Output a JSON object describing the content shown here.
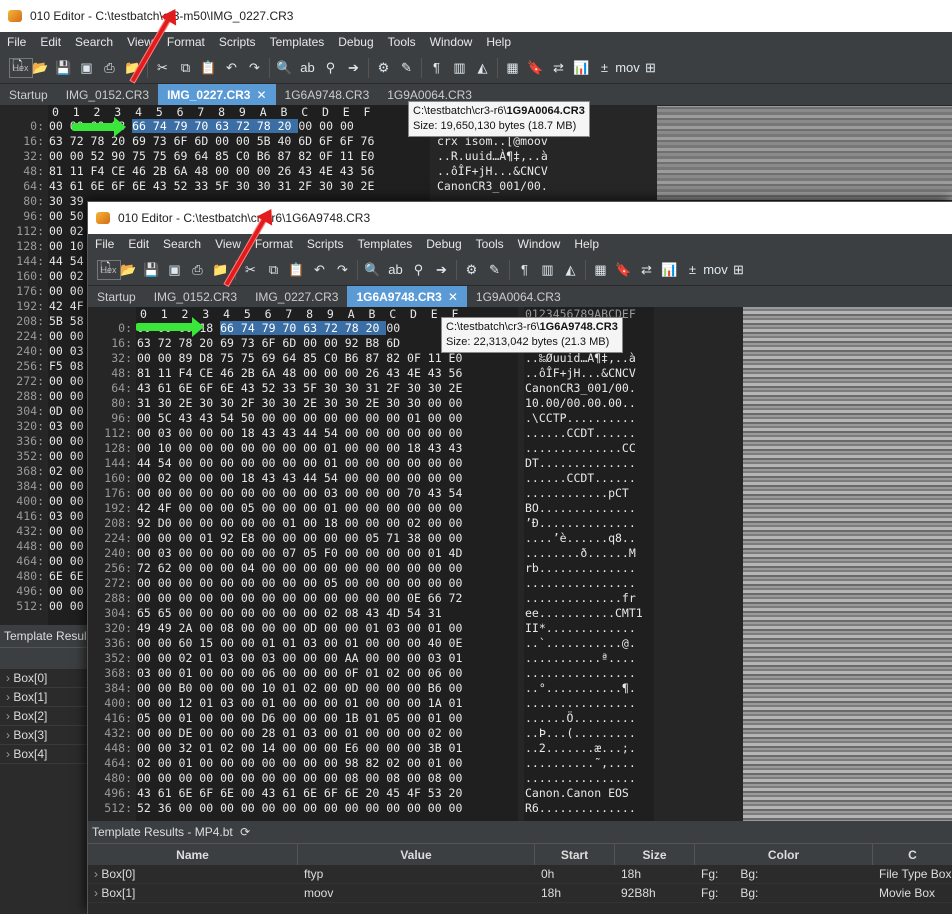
{
  "winA": {
    "title": "010 Editor - C:\\testbatch\\cr3-m50\\IMG_0227.CR3",
    "menu": [
      "File",
      "Edit",
      "Search",
      "View",
      "Format",
      "Scripts",
      "Templates",
      "Debug",
      "Tools",
      "Window",
      "Help"
    ],
    "tabs": [
      {
        "label": "Startup",
        "active": false
      },
      {
        "label": "IMG_0152.CR3",
        "active": false
      },
      {
        "label": "IMG_0227.CR3",
        "active": true,
        "close": "✕"
      },
      {
        "label": "1G6A9748.CR3",
        "active": false
      },
      {
        "label": "1G9A0064.CR3",
        "active": false
      }
    ],
    "col_header": "0  1  2  3  4  5  6  7  8  9  A  B  C  D  E  F",
    "rows": [
      {
        "addr": "0:",
        "hex": "00 00 00 18 66 74 79 70 63 72 78 20 00 00 00",
        "asc": ""
      },
      {
        "addr": "16:",
        "hex": "63 72 78 20 69 73 6F 6D 00 00 5B 40 6D 6F 6F 76",
        "asc": "crx isom..[@moov"
      },
      {
        "addr": "32:",
        "hex": "00 00 52 90 75 75 69 64 85 C0 B6 87 82 0F 11 E0",
        "asc": "..R.uuid…À¶‡‚..à"
      },
      {
        "addr": "48:",
        "hex": "81 11 F4 CE 46 2B 6A 48 00 00 00 26 43 4E 43 56",
        "asc": "..ôÎF+jH...&CNCV"
      },
      {
        "addr": "64:",
        "hex": "43 61 6E 6F 6E 43 52 33 5F 30 30 31 2F 30 30 2E",
        "asc": "CanonCR3_001/00."
      },
      {
        "addr": "80:",
        "hex": "30 39",
        "asc": ""
      },
      {
        "addr": "96:",
        "hex": "00 50",
        "asc": ""
      },
      {
        "addr": "112:",
        "hex": "00 02",
        "asc": ""
      },
      {
        "addr": "128:",
        "hex": "00 10",
        "asc": ""
      },
      {
        "addr": "144:",
        "hex": "44 54",
        "asc": ""
      },
      {
        "addr": "160:",
        "hex": "00 02",
        "asc": ""
      },
      {
        "addr": "176:",
        "hex": "00 00",
        "asc": ""
      },
      {
        "addr": "192:",
        "hex": "42 4F",
        "asc": ""
      },
      {
        "addr": "208:",
        "hex": "5B 58",
        "asc": ""
      },
      {
        "addr": "224:",
        "hex": "00 00",
        "asc": ""
      },
      {
        "addr": "240:",
        "hex": "00 03",
        "asc": ""
      },
      {
        "addr": "256:",
        "hex": "F5 08",
        "asc": ""
      },
      {
        "addr": "272:",
        "hex": "00 00",
        "asc": ""
      },
      {
        "addr": "288:",
        "hex": "00 00",
        "asc": ""
      },
      {
        "addr": "304:",
        "hex": "0D 00",
        "asc": ""
      },
      {
        "addr": "320:",
        "hex": "03 00",
        "asc": ""
      },
      {
        "addr": "336:",
        "hex": "00 00",
        "asc": ""
      },
      {
        "addr": "352:",
        "hex": "00 00",
        "asc": ""
      },
      {
        "addr": "368:",
        "hex": "02 00",
        "asc": ""
      },
      {
        "addr": "384:",
        "hex": "00 00",
        "asc": ""
      },
      {
        "addr": "400:",
        "hex": "00 00",
        "asc": ""
      },
      {
        "addr": "416:",
        "hex": "03 00",
        "asc": ""
      },
      {
        "addr": "432:",
        "hex": "00 00",
        "asc": ""
      },
      {
        "addr": "448:",
        "hex": "00 00",
        "asc": ""
      },
      {
        "addr": "464:",
        "hex": "00 00",
        "asc": ""
      },
      {
        "addr": "480:",
        "hex": "6E 6E",
        "asc": ""
      },
      {
        "addr": "496:",
        "hex": "00 00",
        "asc": ""
      },
      {
        "addr": "512:",
        "hex": "00 00",
        "asc": ""
      }
    ],
    "tooltip": {
      "path": "C:\\testbatch\\cr3-r6\\",
      "file": "1G9A0064.CR3",
      "size": "Size: 19,650,130 bytes (18.7 MB)"
    },
    "template_title": "Template Results",
    "tree": [
      "Box[0]",
      "Box[1]",
      "Box[2]",
      "Box[3]",
      "Box[4]"
    ]
  },
  "winB": {
    "title": "010 Editor - C:\\testbatch\\cr3-r6\\1G6A9748.CR3",
    "menu": [
      "File",
      "Edit",
      "Search",
      "View",
      "Format",
      "Scripts",
      "Templates",
      "Debug",
      "Tools",
      "Window",
      "Help"
    ],
    "tabs": [
      {
        "label": "Startup",
        "active": false
      },
      {
        "label": "IMG_0152.CR3",
        "active": false
      },
      {
        "label": "IMG_0227.CR3",
        "active": false
      },
      {
        "label": "1G6A9748.CR3",
        "active": true,
        "close": "✕"
      },
      {
        "label": "1G9A0064.CR3",
        "active": false
      }
    ],
    "col_header": "0  1  2  3  4  5  6  7  8  9  A  B  C  D  E  F",
    "ascii_header": "0123456789ABCDEF",
    "rows": [
      {
        "addr": "0:",
        "hex": "00 00 00 18 66 74 79 70 63 72 78 20 00",
        "asc": ""
      },
      {
        "addr": "16:",
        "hex": "63 72 78 20 69 73 6F 6D 00 00 92 B8 6D",
        "asc": "ov"
      },
      {
        "addr": "32:",
        "hex": "00 00 89 D8 75 75 69 64 85 C0 B6 87 82 0F 11 E0",
        "asc": "..‰Øuuid…À¶‡‚..à"
      },
      {
        "addr": "48:",
        "hex": "81 11 F4 CE 46 2B 6A 48 00 00 00 26 43 4E 43 56",
        "asc": "..ôÎF+jH...&CNCV"
      },
      {
        "addr": "64:",
        "hex": "43 61 6E 6F 6E 43 52 33 5F 30 30 31 2F 30 30 2E",
        "asc": "CanonCR3_001/00."
      },
      {
        "addr": "80:",
        "hex": "31 30 2E 30 30 2F 30 30 2E 30 30 2E 30 30 00 00",
        "asc": "10.00/00.00.00.."
      },
      {
        "addr": "96:",
        "hex": "00 5C 43 43 54 50 00 00 00 00 00 00 00 01 00 00",
        "asc": ".\\CCTP.........."
      },
      {
        "addr": "112:",
        "hex": "00 03 00 00 00 18 43 43 44 54 00 00 00 00 00 00",
        "asc": "......CCDT......"
      },
      {
        "addr": "128:",
        "hex": "00 10 00 00 00 00 00 00 00 01 00 00 00 18 43 43",
        "asc": "..............CC"
      },
      {
        "addr": "144:",
        "hex": "44 54 00 00 00 00 00 00 00 01 00 00 00 00 00 00",
        "asc": "DT.............."
      },
      {
        "addr": "160:",
        "hex": "00 02 00 00 00 18 43 43 44 54 00 00 00 00 00 00",
        "asc": "......CCDT......"
      },
      {
        "addr": "176:",
        "hex": "00 00 00 00 00 00 00 00 00 03 00 00 00 70 43 54",
        "asc": "............pCT"
      },
      {
        "addr": "192:",
        "hex": "42 4F 00 00 00 05 00 00 00 01 00 00 00 00 00 00",
        "asc": "BO.............."
      },
      {
        "addr": "208:",
        "hex": "92 D0 00 00 00 00 00 01 00 18 00 00 00 02 00 00",
        "asc": "’Ð.............."
      },
      {
        "addr": "224:",
        "hex": "00 00 00 01 92 E8 00 00 00 00 00 05 71 38 00 00",
        "asc": "....’è......q8.."
      },
      {
        "addr": "240:",
        "hex": "00 03 00 00 00 00 00 07 05 F0 00 00 00 00 01 4D",
        "asc": "........ð......M"
      },
      {
        "addr": "256:",
        "hex": "72 62 00 00 00 04 00 00 00 00 00 00 00 00 00 00",
        "asc": "rb.............."
      },
      {
        "addr": "272:",
        "hex": "00 00 00 00 00 00 00 00 00 05 00 00 00 00 00 00",
        "asc": "................"
      },
      {
        "addr": "288:",
        "hex": "00 00 00 00 00 00 00 00 00 00 00 00 00 0E 66 72",
        "asc": "..............fr"
      },
      {
        "addr": "304:",
        "hex": "65 65 00 00 00 00 00 00 00 02 08 43 4D 54 31",
        "asc": "ee...........CMT1"
      },
      {
        "addr": "320:",
        "hex": "49 49 2A 00 08 00 00 00 0D 00 00 01 03 00 01 00",
        "asc": "II*............."
      },
      {
        "addr": "336:",
        "hex": "00 00 60 15 00 00 01 01 03 00 01 00 00 00 40 0E",
        "asc": "..`...........@."
      },
      {
        "addr": "352:",
        "hex": "00 00 02 01 03 00 03 00 00 00 AA 00 00 00 03 01",
        "asc": "...........ª...."
      },
      {
        "addr": "368:",
        "hex": "03 00 01 00 00 00 06 00 00 00 0F 01 02 00 06 00",
        "asc": "................"
      },
      {
        "addr": "384:",
        "hex": "00 00 B0 00 00 00 10 01 02 00 0D 00 00 00 B6 00",
        "asc": "..°...........¶."
      },
      {
        "addr": "400:",
        "hex": "00 00 12 01 03 00 01 00 00 00 01 00 00 00 1A 01",
        "asc": "................"
      },
      {
        "addr": "416:",
        "hex": "05 00 01 00 00 00 D6 00 00 00 1B 01 05 00 01 00",
        "asc": "......Ö........."
      },
      {
        "addr": "432:",
        "hex": "00 00 DE 00 00 00 28 01 03 00 01 00 00 00 02 00",
        "asc": "..Þ...(........."
      },
      {
        "addr": "448:",
        "hex": "00 00 32 01 02 00 14 00 00 00 E6 00 00 00 3B 01",
        "asc": "..2.......æ...;."
      },
      {
        "addr": "464:",
        "hex": "02 00 01 00 00 00 00 00 00 00 98 82 02 00 01 00",
        "asc": "..........˜‚...."
      },
      {
        "addr": "480:",
        "hex": "00 00 00 00 00 00 00 00 00 00 08 00 08 00 08 00",
        "asc": "................"
      },
      {
        "addr": "496:",
        "hex": "43 61 6E 6F 6E 00 43 61 6E 6F 6E 20 45 4F 53 20",
        "asc": "Canon.Canon EOS "
      },
      {
        "addr": "512:",
        "hex": "52 36 00 00 00 00 00 00 00 00 00 00 00 00 00 00",
        "asc": "R6.............."
      }
    ],
    "tooltip": {
      "path": "C:\\testbatch\\cr3-r6\\",
      "file": "1G6A9748.CR3",
      "size": "Size: 22,313,042 bytes (21.3 MB)"
    },
    "template_title": "Template Results - MP4.bt",
    "template_refresh_icon": "refresh-icon",
    "columns": [
      "Name",
      "Value",
      "Start",
      "Size",
      "Color",
      "C"
    ],
    "rows_tmpl": [
      {
        "name": "Box[0]",
        "value": "ftyp",
        "start": "0h",
        "size": "18h",
        "fg": "Fg:",
        "bg": "Bg:",
        "comment": "File Type Box"
      },
      {
        "name": "Box[1]",
        "value": "moov",
        "start": "18h",
        "size": "92B8h",
        "fg": "Fg:",
        "bg": "Bg:",
        "comment": "Movie Box"
      }
    ]
  },
  "colors": {
    "selection": "#3a6ea5",
    "active_tab": "#5b9bd5",
    "green_arrow": "#39e639",
    "red_arrow": "#e21c1c"
  }
}
